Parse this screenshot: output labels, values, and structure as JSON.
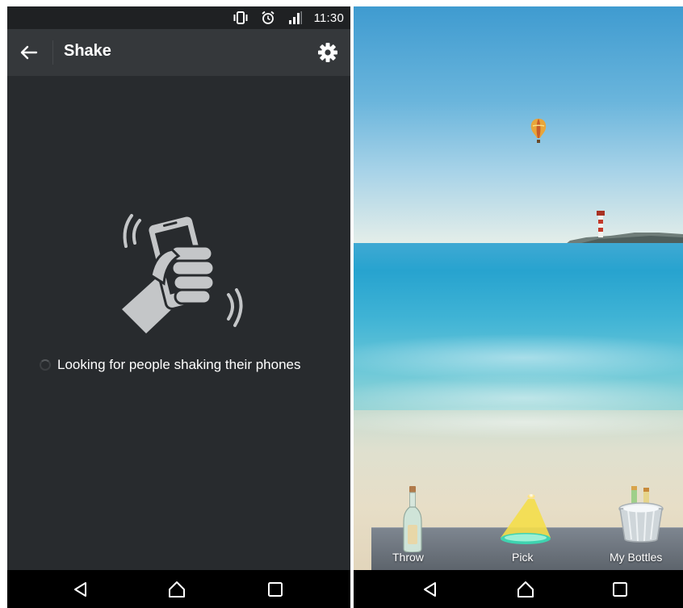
{
  "left_screen": {
    "status_bar": {
      "time": "11:30",
      "icons": [
        "vibrate-icon",
        "alarm-icon",
        "signal-icon"
      ]
    },
    "app_bar": {
      "title": "Shake",
      "back_icon": "back-arrow-icon",
      "settings_icon": "gear-icon"
    },
    "illustration": "hand-shaking-phone-icon",
    "status_message": "Looking for people shaking their phones"
  },
  "right_screen": {
    "scene": [
      "hot-air-balloon",
      "lighthouse",
      "sea",
      "beach"
    ],
    "tray": {
      "throw_label": "Throw",
      "pick_label": "Pick",
      "my_bottles_label": "My Bottles"
    }
  },
  "nav_bar": {
    "buttons": [
      "back-triangle-icon",
      "home-icon",
      "recents-square-icon"
    ]
  },
  "colors": {
    "left_background": "#282b2e",
    "app_bar": "#35383b",
    "status_bar": "#1f2123",
    "nav_bar": "#000000",
    "illustration_gray": "#c4c6c8"
  }
}
